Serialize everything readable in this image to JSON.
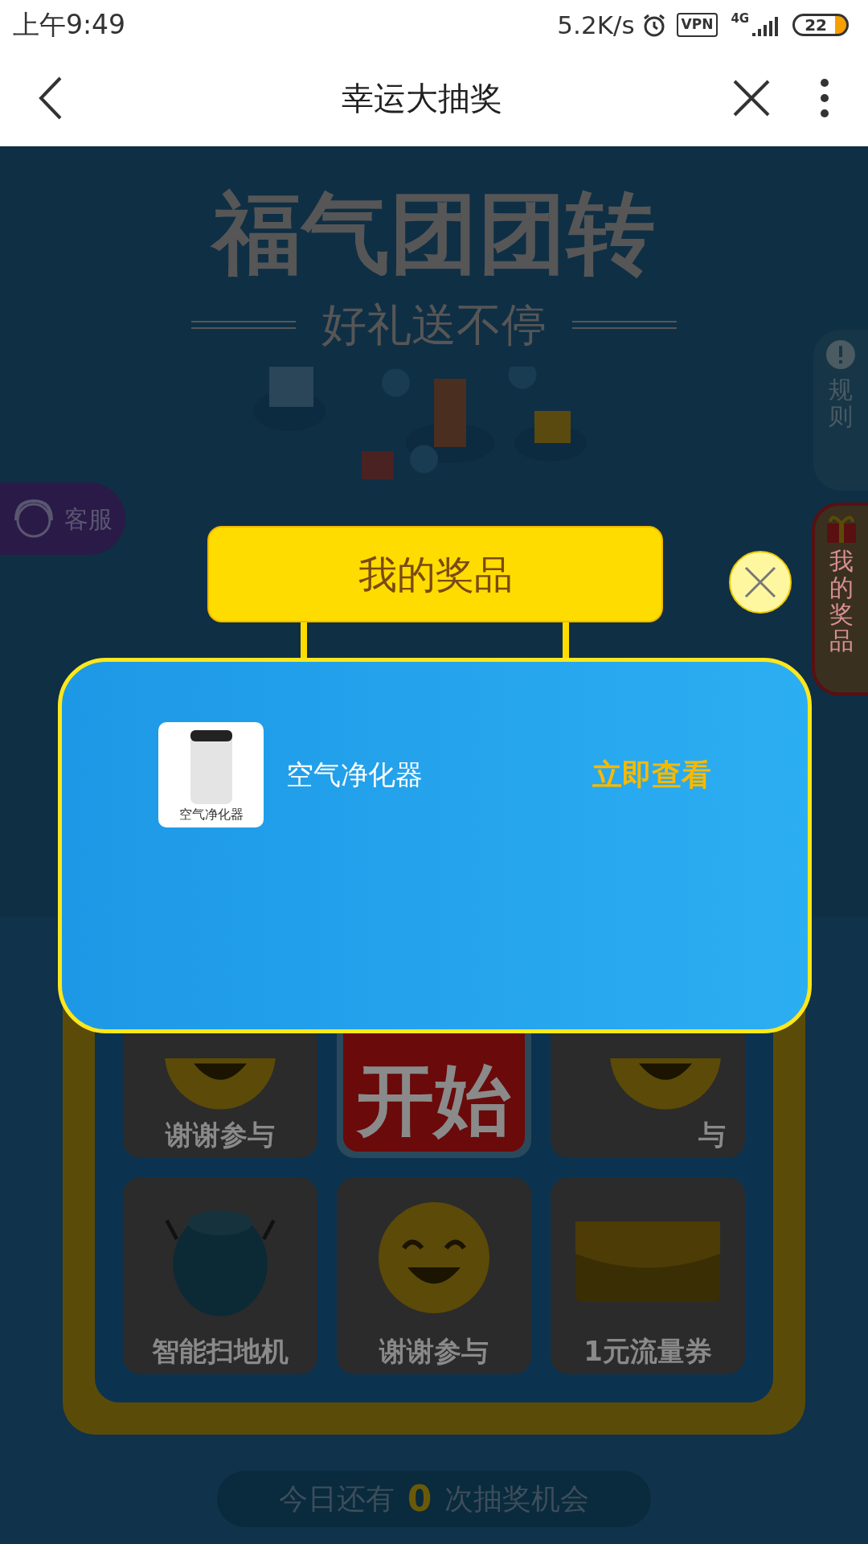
{
  "status_bar": {
    "time": "上午9:49",
    "speed": "5.2K/s",
    "vpn": "VPN",
    "network": "4G",
    "battery": "22"
  },
  "header": {
    "title": "幸运大抽奖"
  },
  "banner": {
    "title": "福气团团转",
    "subtitle": "好礼送不停"
  },
  "side_tabs": {
    "customer_service": "客服",
    "rules": "规则",
    "my_prizes": "我的奖品"
  },
  "board": {
    "cells": [
      {
        "kind": "smiley",
        "label": "谢谢参与"
      },
      {
        "kind": "start",
        "label": "开始"
      },
      {
        "kind": "smiley",
        "label": "与"
      },
      {
        "kind": "robot",
        "label": "智能扫地机"
      },
      {
        "kind": "smiley",
        "label": "谢谢参与"
      },
      {
        "kind": "coupon",
        "label": "1元流量券"
      }
    ]
  },
  "chances": {
    "prefix": "今日还有",
    "count": "0",
    "suffix": "次抽奖机会"
  },
  "modal": {
    "title": "我的奖品",
    "prizes": [
      {
        "name": "空气净化器",
        "thumb_label": "空气净化器",
        "action": "立即查看"
      }
    ]
  }
}
